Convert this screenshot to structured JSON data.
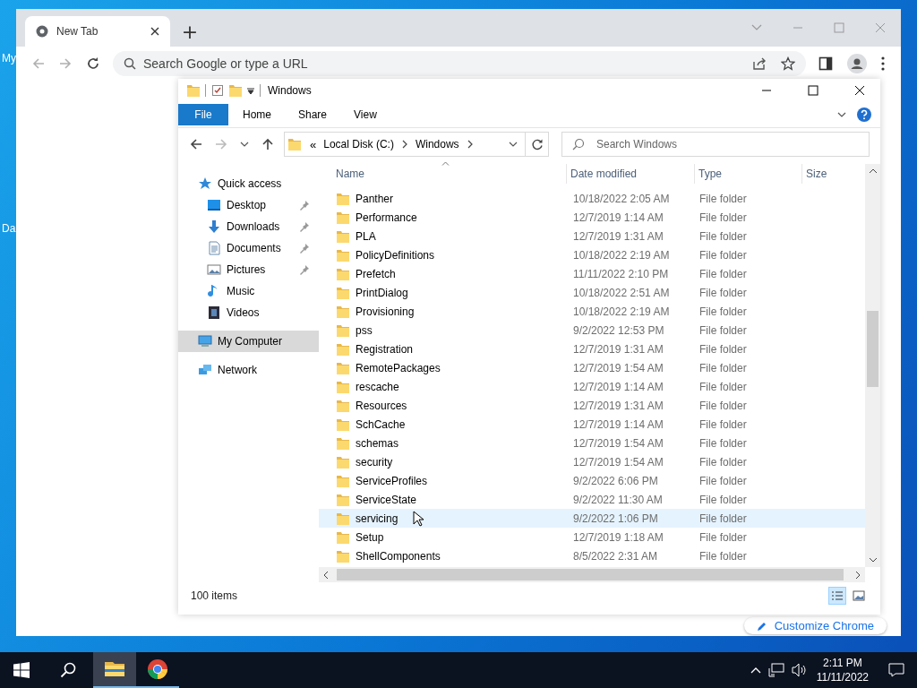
{
  "desktop": {
    "icon_labels": [
      "My",
      "Da"
    ]
  },
  "browser": {
    "tab": {
      "title": "New Tab"
    },
    "new_tab_button": "+",
    "omnibox": {
      "placeholder": "Search Google or type a URL"
    },
    "customize_button": "Customize Chrome"
  },
  "explorer": {
    "title": "Windows",
    "ribbon_tabs": [
      {
        "label": "File",
        "kind": "file"
      },
      {
        "label": "Home",
        "kind": "tab"
      },
      {
        "label": "Share",
        "kind": "tab"
      },
      {
        "label": "View",
        "kind": "tab"
      }
    ],
    "breadcrumb": {
      "overflow": "«",
      "parts": [
        "Local Disk (C:)",
        "Windows"
      ]
    },
    "search": {
      "placeholder": "Search Windows"
    },
    "nav": [
      {
        "label": "Quick access",
        "kind": "quick",
        "selected": false,
        "children": [
          {
            "label": "Desktop",
            "kind": "desktop",
            "pinned": true,
            "selected": false
          },
          {
            "label": "Downloads",
            "kind": "downloads",
            "pinned": true,
            "selected": false
          },
          {
            "label": "Documents",
            "kind": "documents",
            "pinned": true,
            "selected": false
          },
          {
            "label": "Pictures",
            "kind": "pictures",
            "pinned": true,
            "selected": false
          },
          {
            "label": "Music",
            "kind": "music",
            "pinned": false,
            "selected": false
          },
          {
            "label": "Videos",
            "kind": "videos",
            "pinned": false,
            "selected": false
          }
        ]
      },
      {
        "label": "My Computer",
        "kind": "computer",
        "selected": true
      },
      {
        "label": "Network",
        "kind": "network",
        "selected": false
      }
    ],
    "columns": [
      "Name",
      "Date modified",
      "Type",
      "Size"
    ],
    "rows": [
      {
        "name": "Panther",
        "date": "10/18/2022 2:05 AM",
        "type": "File folder",
        "hovered": false
      },
      {
        "name": "Performance",
        "date": "12/7/2019 1:14 AM",
        "type": "File folder",
        "hovered": false
      },
      {
        "name": "PLA",
        "date": "12/7/2019 1:31 AM",
        "type": "File folder",
        "hovered": false
      },
      {
        "name": "PolicyDefinitions",
        "date": "10/18/2022 2:19 AM",
        "type": "File folder",
        "hovered": false
      },
      {
        "name": "Prefetch",
        "date": "11/11/2022 2:10 PM",
        "type": "File folder",
        "hovered": false
      },
      {
        "name": "PrintDialog",
        "date": "10/18/2022 2:51 AM",
        "type": "File folder",
        "hovered": false
      },
      {
        "name": "Provisioning",
        "date": "10/18/2022 2:19 AM",
        "type": "File folder",
        "hovered": false
      },
      {
        "name": "pss",
        "date": "9/2/2022 12:53 PM",
        "type": "File folder",
        "hovered": false
      },
      {
        "name": "Registration",
        "date": "12/7/2019 1:31 AM",
        "type": "File folder",
        "hovered": false
      },
      {
        "name": "RemotePackages",
        "date": "12/7/2019 1:54 AM",
        "type": "File folder",
        "hovered": false
      },
      {
        "name": "rescache",
        "date": "12/7/2019 1:14 AM",
        "type": "File folder",
        "hovered": false
      },
      {
        "name": "Resources",
        "date": "12/7/2019 1:31 AM",
        "type": "File folder",
        "hovered": false
      },
      {
        "name": "SchCache",
        "date": "12/7/2019 1:14 AM",
        "type": "File folder",
        "hovered": false
      },
      {
        "name": "schemas",
        "date": "12/7/2019 1:54 AM",
        "type": "File folder",
        "hovered": false
      },
      {
        "name": "security",
        "date": "12/7/2019 1:54 AM",
        "type": "File folder",
        "hovered": false
      },
      {
        "name": "ServiceProfiles",
        "date": "9/2/2022 6:06 PM",
        "type": "File folder",
        "hovered": false
      },
      {
        "name": "ServiceState",
        "date": "9/2/2022 11:30 AM",
        "type": "File folder",
        "hovered": false
      },
      {
        "name": "servicing",
        "date": "9/2/2022 1:06 PM",
        "type": "File folder",
        "hovered": true
      },
      {
        "name": "Setup",
        "date": "12/7/2019 1:18 AM",
        "type": "File folder",
        "hovered": false
      },
      {
        "name": "ShellComponents",
        "date": "8/5/2022 2:31 AM",
        "type": "File folder",
        "hovered": false
      }
    ],
    "status": "100 items"
  },
  "taskbar": {
    "apps": [
      {
        "kind": "explorer",
        "active": true
      },
      {
        "kind": "chrome",
        "active": false
      }
    ],
    "clock_time": "2:11 PM",
    "clock_date": "11/11/2022"
  }
}
